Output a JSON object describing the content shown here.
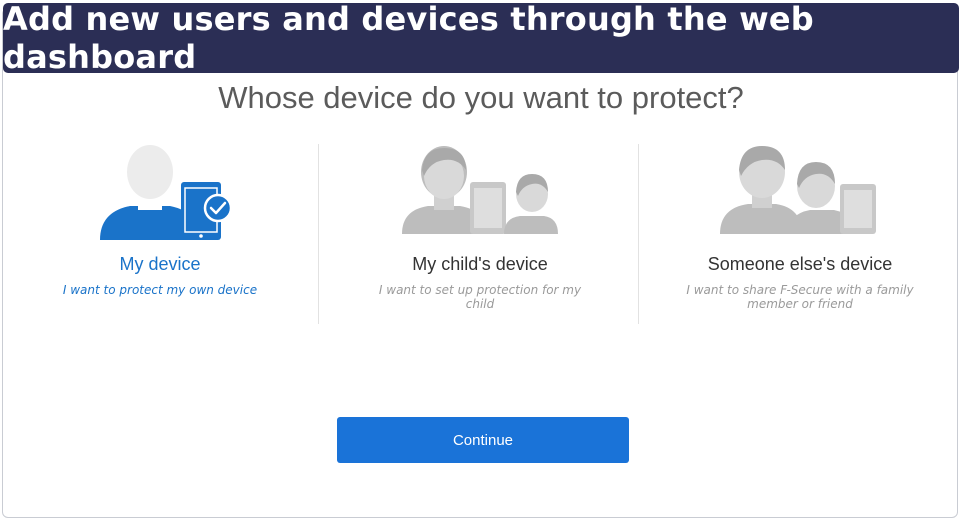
{
  "banner": {
    "text": "Add new users and devices through the web dashboard"
  },
  "question": "Whose device do you want to protect?",
  "options": [
    {
      "title": "My device",
      "description": "I want to protect my own device",
      "selected": true
    },
    {
      "title": "My child's device",
      "description": "I want to set up protection for my child",
      "selected": false
    },
    {
      "title": "Someone else's device",
      "description": "I want to share F-Secure with a family member or friend",
      "selected": false
    }
  ],
  "continue_label": "Continue",
  "colors": {
    "banner_bg": "#2b2e55",
    "accent": "#1a73c9",
    "button": "#1a73d8",
    "muted": "#9a9a9a"
  }
}
